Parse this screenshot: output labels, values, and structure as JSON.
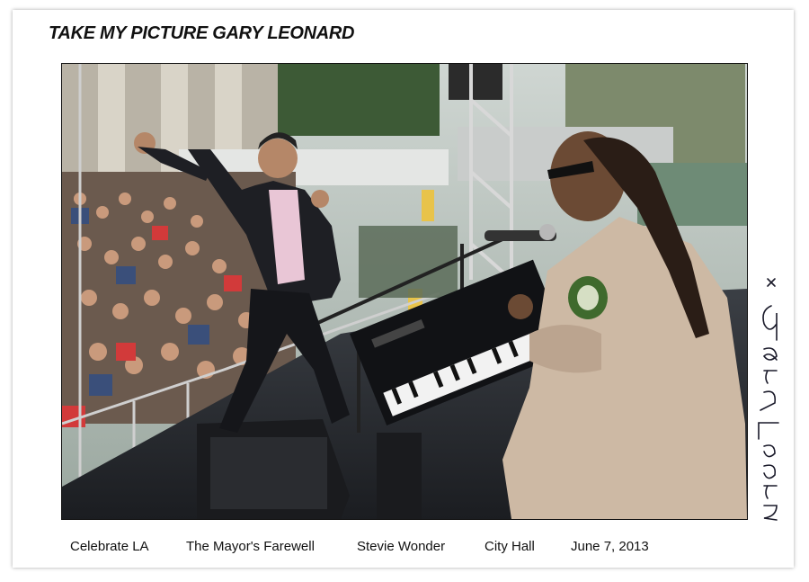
{
  "header": {
    "title": "TAKE MY PICTURE GARY LEONARD"
  },
  "photo": {
    "alt": "Man in black suit dancing next to Stevie Wonder playing keyboard on stage before a crowd"
  },
  "caption": {
    "items": [
      "Celebrate LA",
      "The Mayor's Farewell",
      "Stevie Wonder",
      "City Hall",
      "June 7, 2013"
    ]
  },
  "signature": {
    "text": "Gary Leonard"
  },
  "colors": {
    "border": "#111111",
    "background": "#ffffff"
  }
}
